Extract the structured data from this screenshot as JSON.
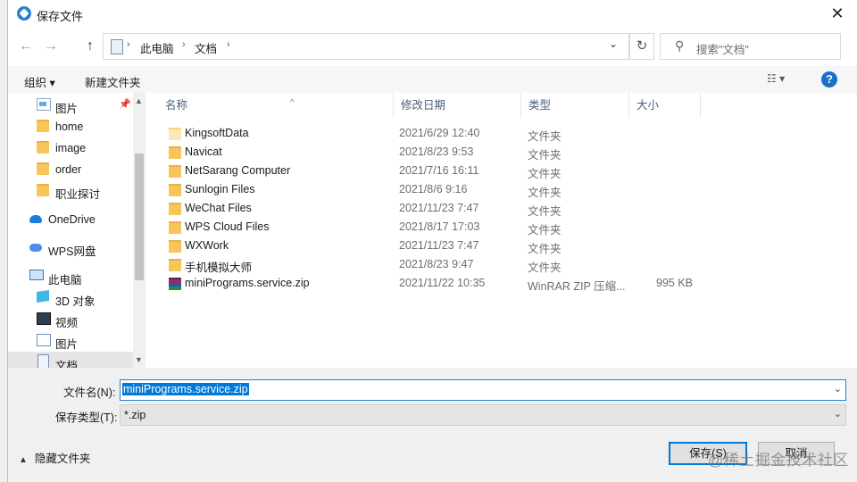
{
  "window": {
    "title": "保存文件",
    "close_glyph": "✕"
  },
  "nav": {
    "back": "←",
    "forward": "→",
    "up": "↑"
  },
  "address": {
    "crumbs": [
      "此电脑",
      "文档"
    ],
    "separator": "›",
    "dropdown": "⌄"
  },
  "refresh_glyph": "↻",
  "search": {
    "placeholder": "搜索\"文档\""
  },
  "toolbar": {
    "organize": "组织 ▾",
    "new_folder": "新建文件夹",
    "view": "☷ ▾",
    "help": "?"
  },
  "sidebar": {
    "items": [
      {
        "label": "图片",
        "icon": "pictures-icon"
      },
      {
        "label": "home",
        "icon": "folder-icon"
      },
      {
        "label": "image",
        "icon": "folder-icon"
      },
      {
        "label": "order",
        "icon": "folder-icon"
      },
      {
        "label": "职业探讨",
        "icon": "folder-icon"
      },
      {
        "label": "OneDrive",
        "icon": "onedrive-icon"
      },
      {
        "label": "WPS网盘",
        "icon": "wps-cloud-icon"
      },
      {
        "label": "此电脑",
        "icon": "pc-icon"
      },
      {
        "label": "3D 对象",
        "icon": "3d-objects-icon"
      },
      {
        "label": "视频",
        "icon": "video-icon"
      },
      {
        "label": "图片",
        "icon": "pictures-icon"
      },
      {
        "label": "文档",
        "icon": "documents-icon",
        "selected": true
      }
    ],
    "pin_glyph": "📌",
    "scroll_up": "▲",
    "scroll_down": "▼"
  },
  "columns": {
    "name": "名称",
    "date": "修改日期",
    "type": "类型",
    "size": "大小",
    "sort_glyph": "^"
  },
  "files": [
    {
      "name": "KingsoftData",
      "date": "2021/6/29 12:40",
      "type": "文件夹",
      "size": ""
    },
    {
      "name": "Navicat",
      "date": "2021/8/23 9:53",
      "type": "文件夹",
      "size": ""
    },
    {
      "name": "NetSarang Computer",
      "date": "2021/7/16 16:11",
      "type": "文件夹",
      "size": ""
    },
    {
      "name": "Sunlogin Files",
      "date": "2021/8/6 9:16",
      "type": "文件夹",
      "size": ""
    },
    {
      "name": "WeChat Files",
      "date": "2021/11/23 7:47",
      "type": "文件夹",
      "size": ""
    },
    {
      "name": "WPS Cloud Files",
      "date": "2021/8/17 17:03",
      "type": "文件夹",
      "size": ""
    },
    {
      "name": "WXWork",
      "date": "2021/11/23 7:47",
      "type": "文件夹",
      "size": ""
    },
    {
      "name": "手机模拟大师",
      "date": "2021/8/23 9:47",
      "type": "文件夹",
      "size": ""
    },
    {
      "name": "miniPrograms.service.zip",
      "date": "2021/11/22 10:35",
      "type": "WinRAR ZIP 压缩...",
      "size": "995 KB"
    }
  ],
  "bottom": {
    "filename_label": "文件名(N):",
    "filename_value": "miniPrograms.service.zip",
    "savetype_label": "保存类型(T):",
    "savetype_value": "*.zip",
    "dropdown_glyph": "⌄",
    "hide_folders": "隐藏文件夹",
    "hide_chevron": "▲",
    "save": "保存(S)",
    "cancel": "取消"
  },
  "watermark": "@稀土掘金技术社区",
  "colors": {
    "accent": "#0078d7",
    "folder": "#f6c65b",
    "help": "#1a6fc7"
  }
}
